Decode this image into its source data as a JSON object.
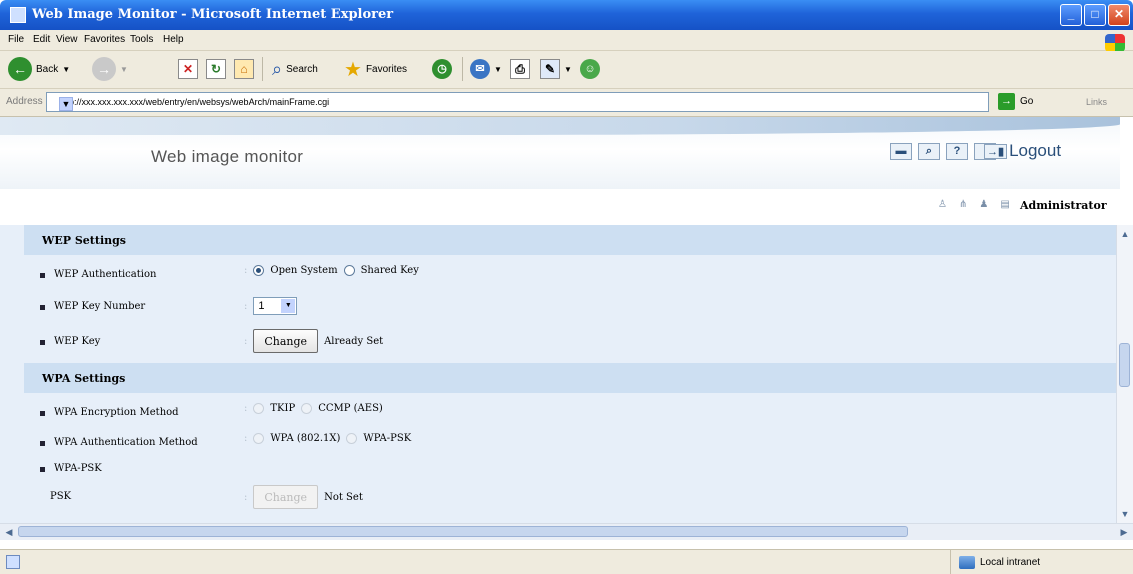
{
  "window": {
    "title": "Web Image Monitor - Microsoft Internet Explorer"
  },
  "menu": [
    "File",
    "Edit",
    "View",
    "Favorites",
    "Tools",
    "Help"
  ],
  "toolbar": {
    "back": "Back",
    "search": "Search",
    "favorites": "Favorites"
  },
  "address": {
    "label": "Address",
    "url": "http://xxx.xxx.xxx.xxx/web/entry/en/websys/webArch/mainFrame.cgi",
    "go": "Go",
    "links": "Links"
  },
  "header": {
    "brand": "Web image monitor",
    "logout": "Logout",
    "user": "Administrator"
  },
  "wep": {
    "title": "WEP Settings",
    "auth_label": "WEP Authentication",
    "auth_options": [
      "Open System",
      "Shared Key"
    ],
    "auth_selected": "Open System",
    "keynum_label": "WEP Key Number",
    "keynum_value": "1",
    "key_label": "WEP Key",
    "change_button": "Change",
    "key_status": "Already Set"
  },
  "wpa": {
    "title": "WPA Settings",
    "enc_label": "WPA Encryption Method",
    "enc_options": [
      "TKIP",
      "CCMP (AES)"
    ],
    "auth_label": "WPA Authentication Method",
    "auth_options": [
      "WPA (802.1X)",
      "WPA-PSK"
    ],
    "psk_section": "WPA-PSK",
    "psk_label": "PSK",
    "change_button": "Change",
    "psk_status": "Not Set"
  },
  "status": {
    "zone": "Local intranet"
  }
}
